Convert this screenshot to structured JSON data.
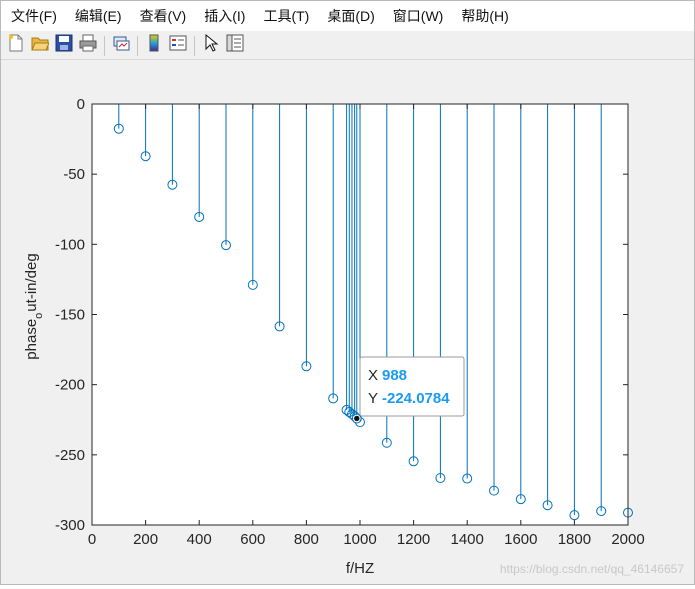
{
  "window": {
    "menu": [
      "文件(F)",
      "编辑(E)",
      "查看(V)",
      "插入(I)",
      "工具(T)",
      "桌面(D)",
      "窗口(W)",
      "帮助(H)"
    ],
    "toolbar": [
      {
        "name": "new-file-icon"
      },
      {
        "name": "open-folder-icon"
      },
      {
        "name": "save-icon"
      },
      {
        "name": "print-icon"
      },
      {
        "sep": true
      },
      {
        "name": "link-plot-icon"
      },
      {
        "sep": true
      },
      {
        "name": "insert-colorbar-icon"
      },
      {
        "name": "insert-legend-icon"
      },
      {
        "sep": true
      },
      {
        "name": "edit-plot-pointer-icon"
      },
      {
        "name": "property-inspector-icon"
      }
    ]
  },
  "chart_data": {
    "type": "stem",
    "title": "",
    "xlabel": "f/HZ",
    "ylabel": "phase_out-in/deg",
    "ylabel_parts": {
      "pre": "phase",
      "sub": "o",
      "post": "ut-in/deg"
    },
    "xlim": [
      0,
      2000
    ],
    "ylim": [
      -300,
      0
    ],
    "xticks": [
      0,
      200,
      400,
      600,
      800,
      1000,
      1200,
      1400,
      1600,
      1800,
      2000
    ],
    "yticks": [
      0,
      -50,
      -100,
      -150,
      -200,
      -250,
      -300
    ],
    "tick_labels_x": [
      "0",
      "200",
      "400",
      "600",
      "800",
      "1000",
      "1200",
      "1400",
      "1600",
      "1800",
      "2000"
    ],
    "tick_labels_y": [
      "0",
      "-50",
      "-100",
      "-150",
      "-200",
      "-250",
      "-300"
    ],
    "grid": false,
    "color": "#0072BD",
    "series": [
      {
        "x": [
          100,
          200,
          300,
          400,
          500,
          600,
          700,
          800,
          900,
          950,
          960,
          970,
          980,
          988,
          1000,
          1100,
          1200,
          1300,
          1400,
          1500,
          1600,
          1700,
          1800,
          1900,
          2000
        ],
        "y": [
          -17.6,
          -37.2,
          -57.5,
          -80.5,
          -100.6,
          -128.9,
          -158.5,
          -186.9,
          -209.8,
          -218.0,
          -219.5,
          -221.0,
          -222.5,
          -224.0784,
          -226.7,
          -241.4,
          -254.6,
          -266.5,
          -266.9,
          -275.5,
          -281.6,
          -285.9,
          -293.0,
          -290.1,
          -291.2
        ]
      }
    ],
    "datatip": {
      "x_label": "X",
      "x_value": "988",
      "y_label": "Y",
      "y_value": "-224.0784",
      "x": 988,
      "y": -224.0784
    }
  },
  "watermark": "https://blog.csdn.net/qq_46146657"
}
